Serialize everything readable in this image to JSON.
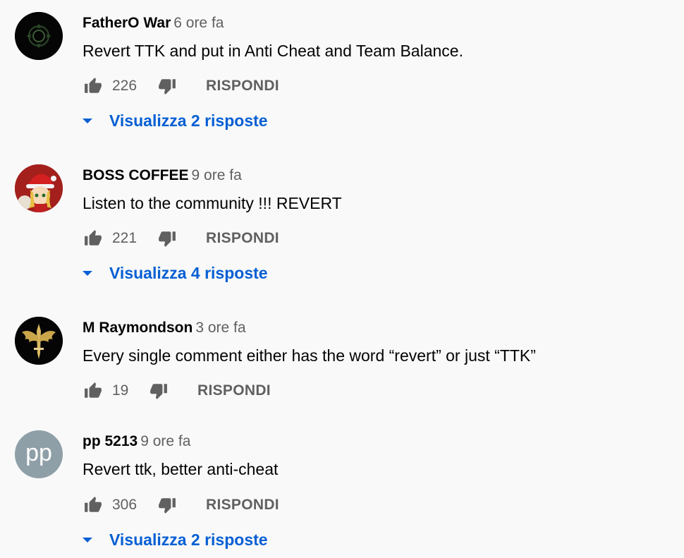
{
  "comments": [
    {
      "author": "FatherO War",
      "time": "6 ore fa",
      "text": "Revert TTK and put in Anti Cheat and Team Balance.",
      "likes": "226",
      "reply_label": "RISPONDI",
      "replies_label": "Visualizza 2 risposte"
    },
    {
      "author": "BOSS COFFEE",
      "time": "9 ore fa",
      "text": "Listen to the community !!! REVERT",
      "likes": "221",
      "reply_label": "RISPONDI",
      "replies_label": "Visualizza 4 risposte"
    },
    {
      "author": "M Raymondson",
      "time": "3 ore fa",
      "text": "Every single comment either has the word “revert” or just “TTK”",
      "likes": "19",
      "reply_label": "RISPONDI"
    },
    {
      "author": "pp 5213",
      "time": "9 ore fa",
      "text": "Revert ttk, better anti-cheat",
      "likes": "306",
      "reply_label": "RISPONDI",
      "replies_label": "Visualizza 2 risposte",
      "avatar_initials": "pp"
    }
  ],
  "colors": {
    "link_blue": "#065fd4",
    "secondary_text": "#606060",
    "background": "#f9f9f9"
  }
}
